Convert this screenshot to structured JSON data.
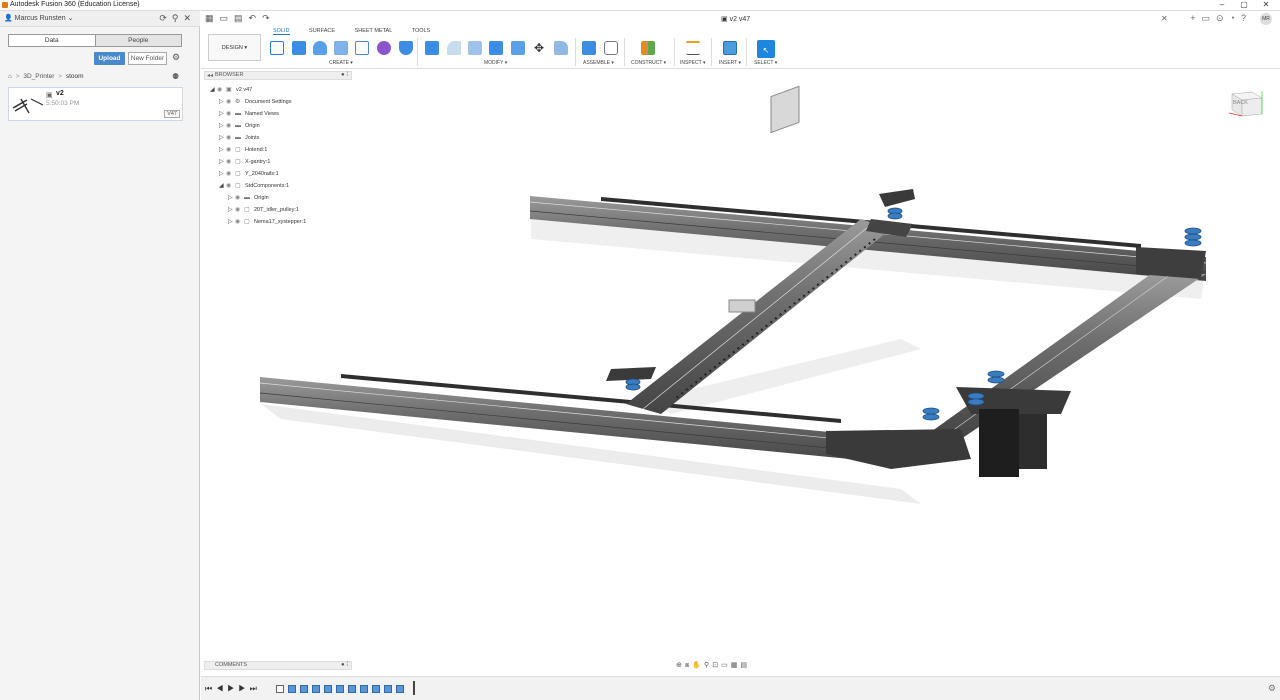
{
  "window": {
    "title": "Autodesk Fusion 360 (Education License)",
    "controls": [
      "–",
      "▢",
      "✕"
    ]
  },
  "left_panel": {
    "user": "Marcus Runsten",
    "tabs": [
      "Data",
      "People"
    ],
    "upload_label": "Upload",
    "new_folder_label": "New Folder",
    "breadcrumb": [
      "3D_Printer",
      "stoom"
    ],
    "file": {
      "name": "v2",
      "time": "5:50:03 PM",
      "version": "V47"
    }
  },
  "doc_tab": {
    "title": "v2 v47"
  },
  "ribbon": {
    "workspace": "DESIGN",
    "tabs": [
      "SOLID",
      "SURFACE",
      "SHEET METAL",
      "TOOLS"
    ],
    "groups": [
      "CREATE",
      "MODIFY",
      "ASSEMBLE",
      "CONSTRUCT",
      "INSPECT",
      "INSERT",
      "SELECT"
    ]
  },
  "browser": {
    "label": "BROWSER",
    "items": [
      {
        "label": "v2 v47",
        "depth": 0,
        "expanded": true,
        "icon": "document-icon"
      },
      {
        "label": "Document Settings",
        "depth": 1,
        "expanded": false,
        "icon": "gear-icon"
      },
      {
        "label": "Named Views",
        "depth": 1,
        "expanded": false,
        "icon": "folder-icon"
      },
      {
        "label": "Origin",
        "depth": 1,
        "expanded": false,
        "icon": "folder-icon"
      },
      {
        "label": "Joints",
        "depth": 1,
        "expanded": false,
        "icon": "folder-icon"
      },
      {
        "label": "Hotend:1",
        "depth": 1,
        "expanded": false,
        "icon": "component-icon"
      },
      {
        "label": "X-gantry:1",
        "depth": 1,
        "expanded": false,
        "icon": "component-icon"
      },
      {
        "label": "Y_2040rails:1",
        "depth": 1,
        "expanded": false,
        "icon": "component-icon"
      },
      {
        "label": "StdComponents:1",
        "depth": 1,
        "expanded": true,
        "icon": "component-icon"
      },
      {
        "label": "Origin",
        "depth": 2,
        "expanded": false,
        "icon": "folder-icon"
      },
      {
        "label": "20T_idler_pulley:1",
        "depth": 2,
        "expanded": false,
        "icon": "component-icon"
      },
      {
        "label": "Nema17_xystepper:1",
        "depth": 2,
        "expanded": false,
        "icon": "component-icon"
      }
    ]
  },
  "comments": {
    "label": "COMMENTS"
  },
  "viewcube": {
    "face": "BACK"
  },
  "colors": {
    "accent": "#1a7ad0",
    "upload": "#4a8ac8",
    "timeline_feature": "#5b95d8"
  }
}
